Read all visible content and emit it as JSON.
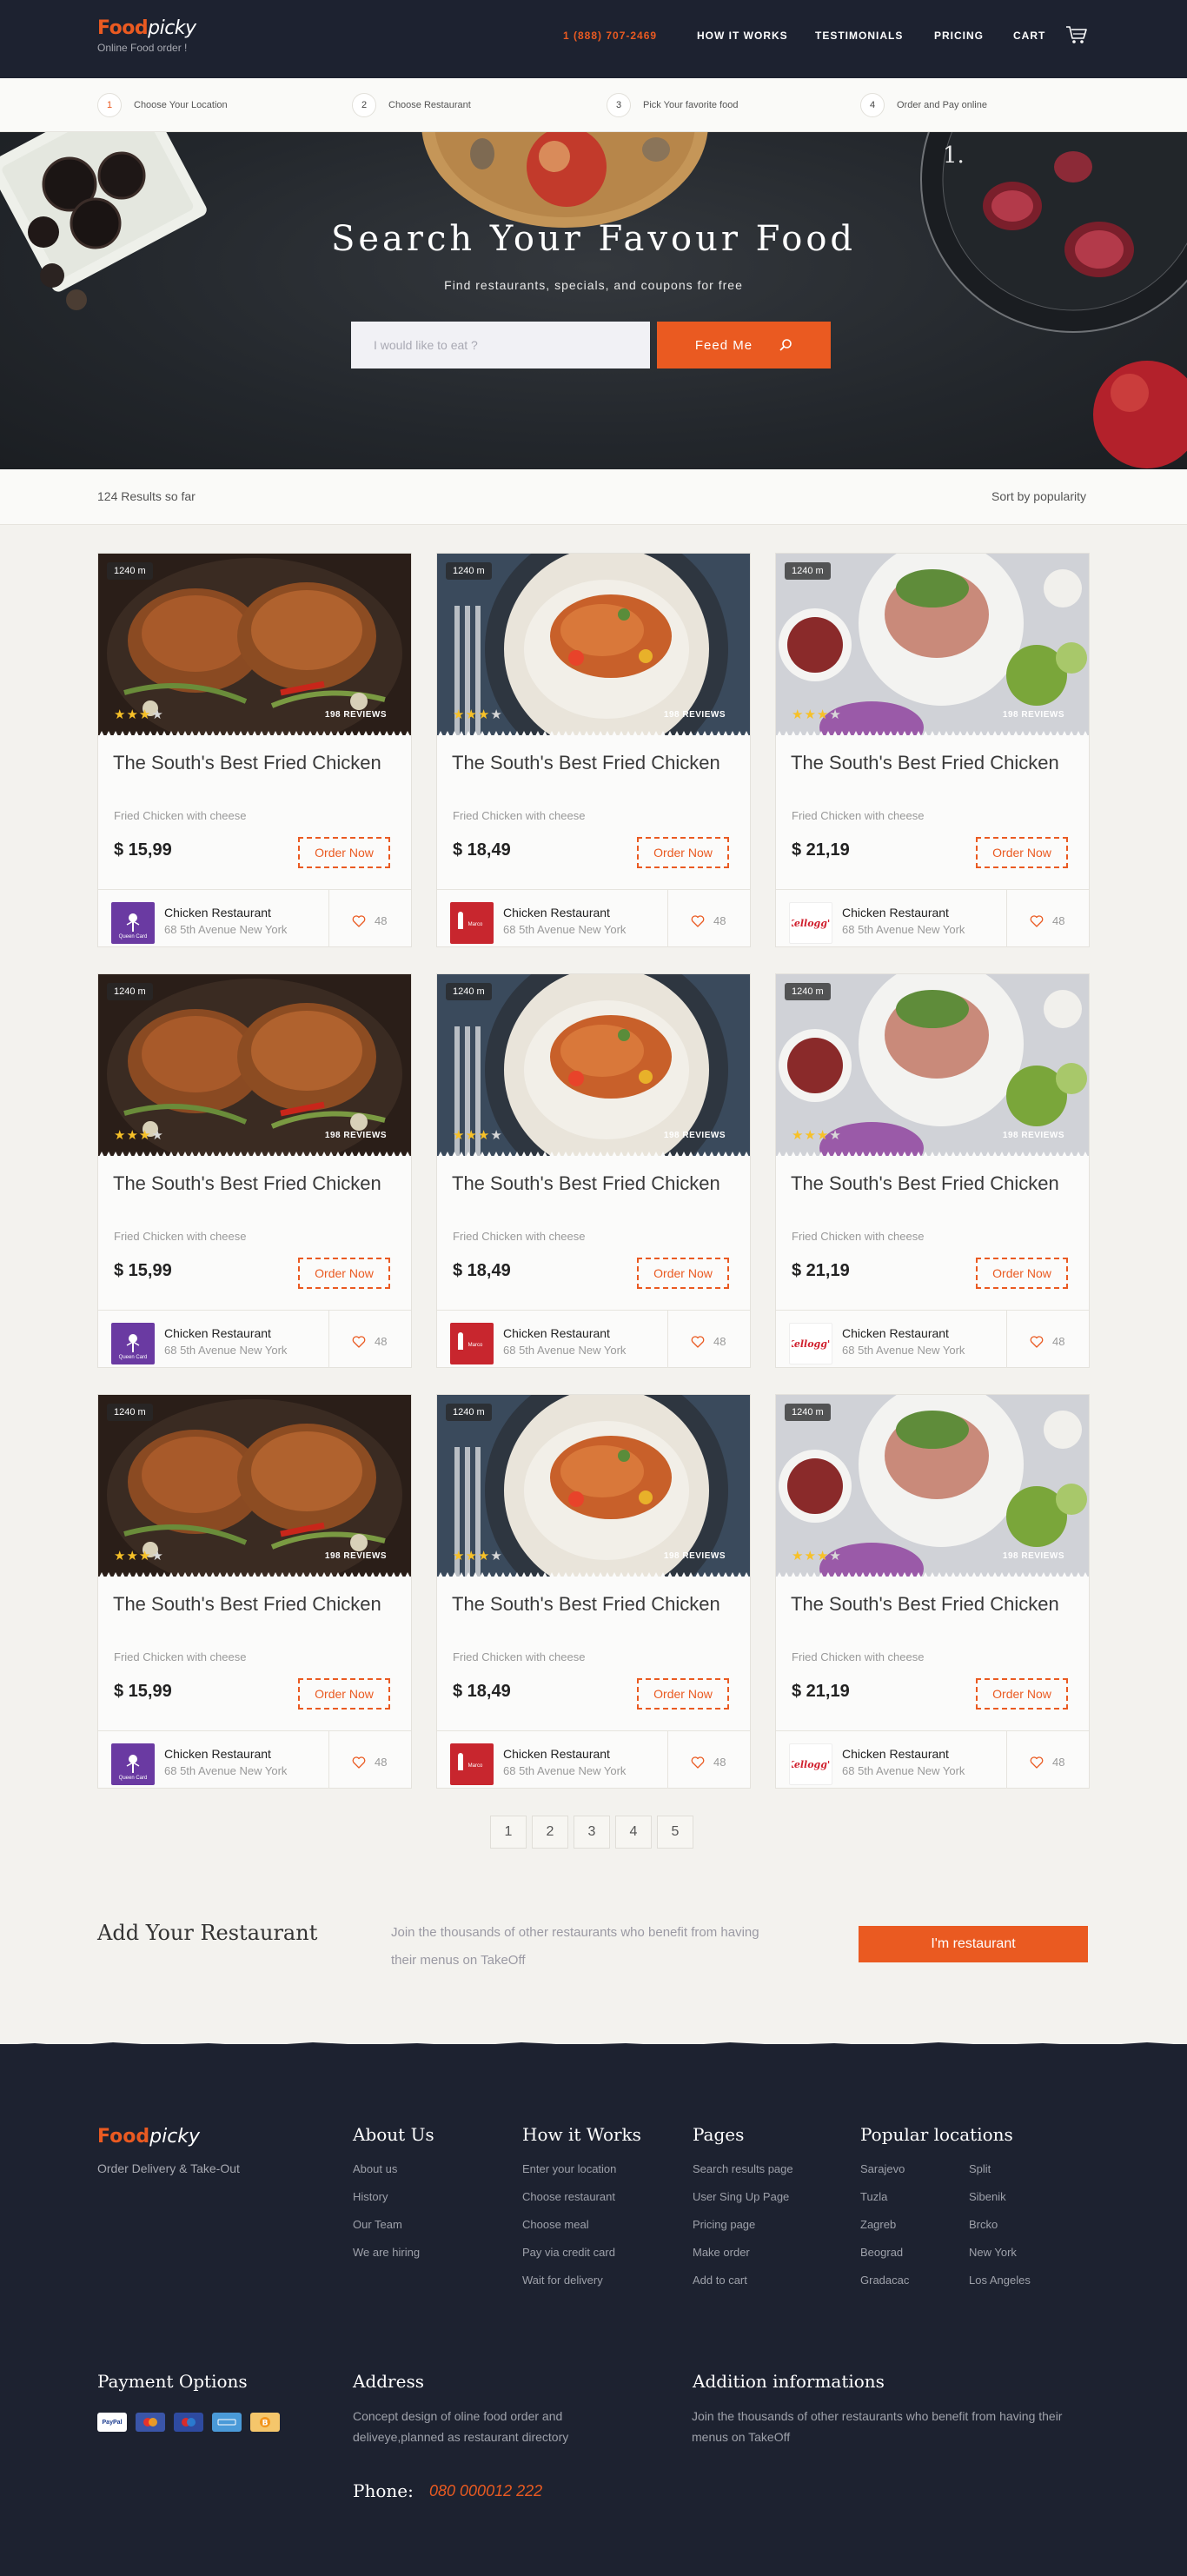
{
  "header": {
    "logo_food": "Food",
    "logo_picky": "picky",
    "tagline": "Online Food order !",
    "phone": "1 (888) 707-2469",
    "nav": [
      "HOW IT WORKS",
      "TESTIMONIALS",
      "PRICING",
      "CART"
    ]
  },
  "steps": [
    {
      "num": "1",
      "label": "Choose Your Location"
    },
    {
      "num": "2",
      "label": "Choose Restaurant"
    },
    {
      "num": "3",
      "label": "Pick Your favorite food"
    },
    {
      "num": "4",
      "label": "Order and Pay online"
    }
  ],
  "hero": {
    "title": "Search Your Favour Food",
    "subtitle": "Find restaurants, specials, and coupons for free",
    "search_placeholder": "I would like to eat ?",
    "button": "Feed Me"
  },
  "results": {
    "count": "124 Results so far",
    "sort": "Sort by popularity"
  },
  "cards": [
    {
      "distance": "1240 m",
      "reviews": "198 REVIEWS",
      "title": "The South's Best Fried Chicken",
      "desc": "Fried Chicken with cheese",
      "price": "$ 15,99",
      "order": "Order Now",
      "rest_name": "Chicken Restaurant",
      "rest_addr": "68 5th Avenue New York",
      "likes": "48",
      "logo": "Queen Card"
    },
    {
      "distance": "1240 m",
      "reviews": "198 REVIEWS",
      "title": "The South's Best Fried Chicken",
      "desc": "Fried Chicken with cheese",
      "price": "$ 18,49",
      "order": "Order Now",
      "rest_name": "Chicken Restaurant",
      "rest_addr": "68 5th Avenue New York",
      "likes": "48",
      "logo": "Marco Pollo"
    },
    {
      "distance": "1240 m",
      "reviews": "198 REVIEWS",
      "title": "The South's Best Fried Chicken",
      "desc": "Fried Chicken with cheese",
      "price": "$ 21,19",
      "order": "Order Now",
      "rest_name": "Chicken Restaurant",
      "rest_addr": "68 5th Avenue New York",
      "likes": "48",
      "logo": "Kellogg's"
    },
    {
      "distance": "1240 m",
      "reviews": "198 REVIEWS",
      "title": "The South's Best Fried Chicken",
      "desc": "Fried Chicken with cheese",
      "price": "$ 15,99",
      "order": "Order Now",
      "rest_name": "Chicken Restaurant",
      "rest_addr": "68 5th Avenue New York",
      "likes": "48",
      "logo": "Queen Card"
    },
    {
      "distance": "1240 m",
      "reviews": "198 REVIEWS",
      "title": "The South's Best Fried Chicken",
      "desc": "Fried Chicken with cheese",
      "price": "$ 18,49",
      "order": "Order Now",
      "rest_name": "Chicken Restaurant",
      "rest_addr": "68 5th Avenue New York",
      "likes": "48",
      "logo": "Marco Pollo"
    },
    {
      "distance": "1240 m",
      "reviews": "198 REVIEWS",
      "title": "The South's Best Fried Chicken",
      "desc": "Fried Chicken with cheese",
      "price": "$ 21,19",
      "order": "Order Now",
      "rest_name": "Chicken Restaurant",
      "rest_addr": "68 5th Avenue New York",
      "likes": "48",
      "logo": "Kellogg's"
    },
    {
      "distance": "1240 m",
      "reviews": "198 REVIEWS",
      "title": "The South's Best Fried Chicken",
      "desc": "Fried Chicken with cheese",
      "price": "$ 15,99",
      "order": "Order Now",
      "rest_name": "Chicken Restaurant",
      "rest_addr": "68 5th Avenue New York",
      "likes": "48",
      "logo": "Queen Card"
    },
    {
      "distance": "1240 m",
      "reviews": "198 REVIEWS",
      "title": "The South's Best Fried Chicken",
      "desc": "Fried Chicken with cheese",
      "price": "$ 18,49",
      "order": "Order Now",
      "rest_name": "Chicken Restaurant",
      "rest_addr": "68 5th Avenue New York",
      "likes": "48",
      "logo": "Marco Pollo"
    },
    {
      "distance": "1240 m",
      "reviews": "198 REVIEWS",
      "title": "The South's Best Fried Chicken",
      "desc": "Fried Chicken with cheese",
      "price": "$ 21,19",
      "order": "Order Now",
      "rest_name": "Chicken Restaurant",
      "rest_addr": "68 5th Avenue New York",
      "likes": "48",
      "logo": "Kellogg's"
    }
  ],
  "pagination": [
    "1",
    "2",
    "3",
    "4",
    "5"
  ],
  "add_restaurant": {
    "title": "Add Your Restaurant",
    "text": "Join the thousands of other restaurants who benefit from having their menus on TakeOff",
    "button": "I'm restaurant"
  },
  "footer": {
    "tagline": "Order Delivery & Take-Out",
    "about": {
      "title": "About Us",
      "links": [
        "About us",
        "History",
        "Our Team",
        "We are hiring"
      ]
    },
    "how": {
      "title": "How it Works",
      "links": [
        "Enter your location",
        "Choose restaurant",
        "Choose meal",
        "Pay via credit card",
        "Wait for delivery"
      ]
    },
    "pages": {
      "title": "Pages",
      "links": [
        "Search results page",
        "User Sing Up Page",
        "Pricing page",
        "Make order",
        "Add to cart"
      ]
    },
    "locations": {
      "title": "Popular locations",
      "col1": [
        "Sarajevo",
        "Tuzla",
        "Zagreb",
        "Beograd",
        "Gradacac"
      ],
      "col2": [
        "Split",
        "Sibenik",
        "Brcko",
        "New York",
        "Los Angeles"
      ]
    },
    "payment": {
      "title": "Payment Options",
      "methods": [
        "PayPal",
        "Mastercard",
        "Maestro",
        "Amex",
        "Bitcoin"
      ]
    },
    "address": {
      "title": "Address",
      "text": "Concept design of oline food order and deliveye,planned as restaurant directory",
      "phone_label": "Phone:",
      "phone": "080 000012 222"
    },
    "info": {
      "title": "Addition informations",
      "text": "Join the thousands of other restaurants who benefit from having their menus on TakeOff"
    }
  },
  "colors": {
    "accent": "#ea5a21",
    "dark": "#1d2230",
    "star": "#f7c128"
  }
}
